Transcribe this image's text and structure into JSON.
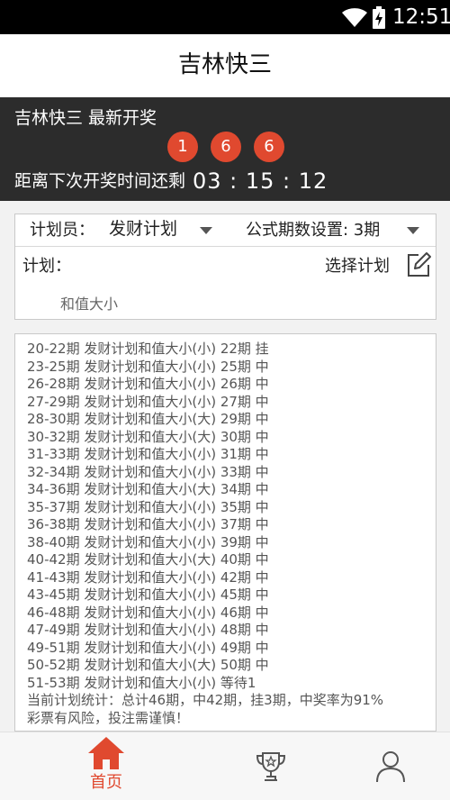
{
  "status_bar": {
    "time": "12:51"
  },
  "header": {
    "title": "吉林快三"
  },
  "latest_draw": {
    "label": "吉林快三 最新开奖",
    "balls": [
      "1",
      "6",
      "6"
    ],
    "countdown_label": "距离下次开奖时间还剩",
    "countdown_time": "03 : 15 : 12"
  },
  "plan_settings": {
    "planner_label": "计划员：",
    "planner_value": "发财计划",
    "periods_label": "公式期数设置: 3期",
    "plan_label": "计划：",
    "choose_plan": "选择计划",
    "plan_name": "和值大小"
  },
  "records": [
    "20-22期 发财计划和值大小(小) 22期 挂",
    "23-25期 发财计划和值大小(小) 25期 中",
    "26-28期 发财计划和值大小(小) 26期 中",
    "27-29期 发财计划和值大小(小) 27期 中",
    "28-30期 发财计划和值大小(大) 29期 中",
    "30-32期 发财计划和值大小(大) 30期 中",
    "31-33期 发财计划和值大小(小) 31期 中",
    "32-34期 发财计划和值大小(小) 33期 中",
    "34-36期 发财计划和值大小(大) 34期 中",
    "35-37期 发财计划和值大小(小) 35期 中",
    "36-38期 发财计划和值大小(小) 37期 中",
    "38-40期 发财计划和值大小(小) 39期 中",
    "40-42期 发财计划和值大小(大) 40期 中",
    "41-43期 发财计划和值大小(小) 42期 中",
    "43-45期 发财计划和值大小(小) 45期 中",
    "46-48期 发财计划和值大小(小) 46期 中",
    "47-49期 发财计划和值大小(小) 48期 中",
    "49-51期 发财计划和值大小(小) 49期 中",
    "50-52期 发财计划和值大小(大) 50期 中",
    "51-53期 发财计划和值大小(小) 等待1"
  ],
  "summary": "当前计划统计：总计46期，中42期，挂3期，中奖率为91%",
  "warning": "彩票有风险，投注需谨慎！",
  "bottom_nav": {
    "home_label": "首页",
    "active_color": "#e0492f"
  }
}
